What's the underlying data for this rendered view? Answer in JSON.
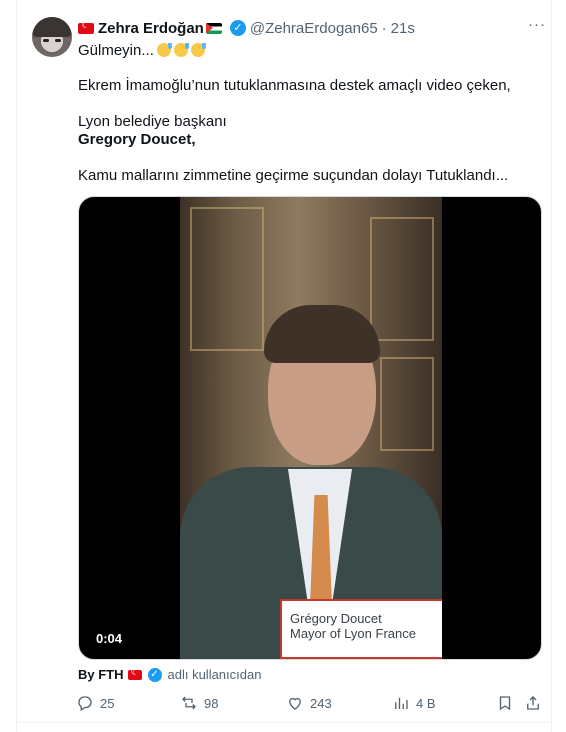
{
  "post": {
    "author_name": "Zehra Erdoğan",
    "handle": "@ZehraErdogan65",
    "time_ago": "21s",
    "more_label": "···",
    "lines": [
      "Gülmeyin...",
      "Ekrem İmamoğlu’nun tutuklanmasına destek amaçlı video çeken,",
      "Lyon belediye başkanı",
      "Gregory Doucet,",
      "Kamu mallarını zimmetine geçirme suçundan dolayı Tutuklandı..."
    ]
  },
  "video": {
    "caption_line1": "Grégory Doucet",
    "caption_line2": "Mayor of Lyon France",
    "timestamp": "0:04"
  },
  "attribution": {
    "by": "By FTH",
    "source": "adlı kullanıcıdan"
  },
  "actions": {
    "replies": "25",
    "reposts": "98",
    "likes": "243",
    "views": "4 B"
  },
  "colors": {
    "accent": "#1d9bf0",
    "secondary_text": "#536471",
    "border": "#eff3f4"
  }
}
